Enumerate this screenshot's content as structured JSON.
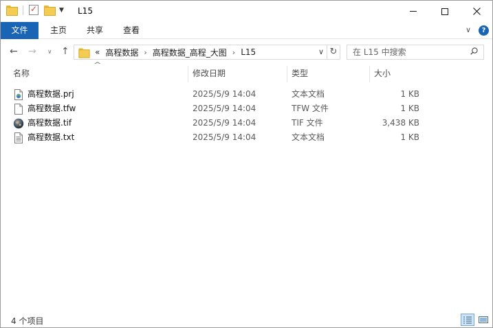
{
  "window": {
    "title": "L15"
  },
  "ribbon": {
    "file": "文件",
    "home": "主页",
    "share": "共享",
    "view": "查看"
  },
  "address": {
    "overflow": "«",
    "crumbs": [
      "高程数据",
      "高程数据_高程_大图",
      "L15"
    ]
  },
  "search": {
    "placeholder": "在 L15 中搜索"
  },
  "columns": {
    "name": "名称",
    "date": "修改日期",
    "type": "类型",
    "size": "大小"
  },
  "files": [
    {
      "name": "高程数据.prj",
      "date": "2025/5/9 14:04",
      "type": "文本文档",
      "size": "1 KB",
      "icon": "prj-file-icon"
    },
    {
      "name": "高程数据.tfw",
      "date": "2025/5/9 14:04",
      "type": "TFW 文件",
      "size": "1 KB",
      "icon": "blank-file-icon"
    },
    {
      "name": "高程数据.tif",
      "date": "2025/5/9 14:04",
      "type": "TIF 文件",
      "size": "3,438 KB",
      "icon": "globe-file-icon"
    },
    {
      "name": "高程数据.txt",
      "date": "2025/5/9 14:04",
      "type": "文本文档",
      "size": "1 KB",
      "icon": "text-file-icon"
    }
  ],
  "status": {
    "count": "4 个项目"
  },
  "colors": {
    "accent": "#1a64b5",
    "folder": "#f5cc52",
    "selected_view": "#cce4f7"
  }
}
